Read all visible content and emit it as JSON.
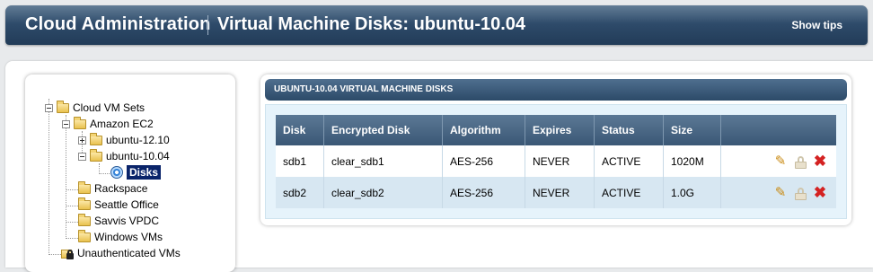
{
  "header": {
    "app_title": "Cloud Administration",
    "page_title": "Virtual Machine Disks: ubuntu-10.04",
    "show_tips": "Show tips"
  },
  "tree": {
    "nodes": [
      {
        "label": "Cloud VM Sets",
        "icon": "folder-icon",
        "expanded": true,
        "level": 0
      },
      {
        "label": "Amazon EC2",
        "icon": "folder-icon",
        "expanded": true,
        "level": 1
      },
      {
        "label": "ubuntu-12.10",
        "icon": "folder-icon",
        "expanded": false,
        "level": 2
      },
      {
        "label": "ubuntu-10.04",
        "icon": "folder-icon",
        "expanded": true,
        "level": 2
      },
      {
        "label": "Disks",
        "icon": "disk-icon",
        "selected": true,
        "level": 3
      },
      {
        "label": "Rackspace",
        "icon": "folder-icon",
        "level": 1
      },
      {
        "label": "Seattle Office",
        "icon": "folder-icon",
        "level": 1
      },
      {
        "label": "Savvis VPDC",
        "icon": "folder-icon",
        "level": 1
      },
      {
        "label": "Windows VMs",
        "icon": "folder-icon",
        "level": 1
      },
      {
        "label": "Unauthenticated VMs",
        "icon": "locked-folder-icon",
        "level": 0
      }
    ]
  },
  "disks_panel": {
    "title": "UBUNTU-10.04 VIRTUAL MACHINE DISKS",
    "columns": [
      "Disk",
      "Encrypted Disk",
      "Algorithm",
      "Expires",
      "Status",
      "Size",
      ""
    ],
    "rows": [
      {
        "disk": "sdb1",
        "encrypted_disk": "clear_sdb1",
        "algorithm": "AES-256",
        "expires": "NEVER",
        "status": "ACTIVE",
        "size": "1020M"
      },
      {
        "disk": "sdb2",
        "encrypted_disk": "clear_sdb2",
        "algorithm": "AES-256",
        "expires": "NEVER",
        "status": "ACTIVE",
        "size": "1.0G"
      }
    ],
    "row_actions": [
      "edit-pencil-icon",
      "lock-icon",
      "delete-x-icon"
    ]
  },
  "colors": {
    "header_bg": "#2c4867",
    "table_header_bg": "#3a5775",
    "panel_body_bg": "#e6f3fb",
    "alt_row_bg": "#d7e7f2",
    "selected_node_bg": "#0a246a",
    "delete_color": "#d42222"
  }
}
